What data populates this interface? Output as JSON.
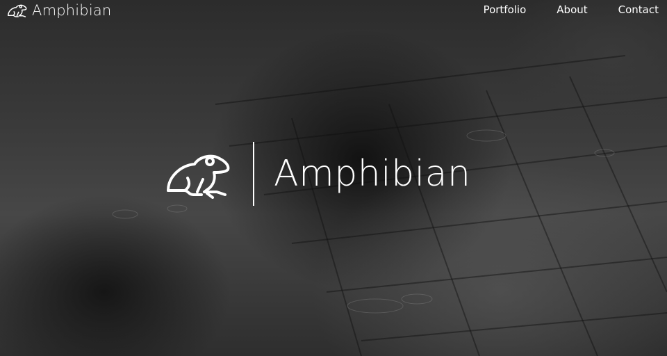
{
  "brand": {
    "name": "Amphibian",
    "icon": "frog-icon"
  },
  "nav": {
    "items": [
      {
        "label": "Portfolio"
      },
      {
        "label": "About"
      },
      {
        "label": "Contact"
      }
    ]
  },
  "hero": {
    "title": "Amphibian",
    "icon": "frog-icon"
  }
}
